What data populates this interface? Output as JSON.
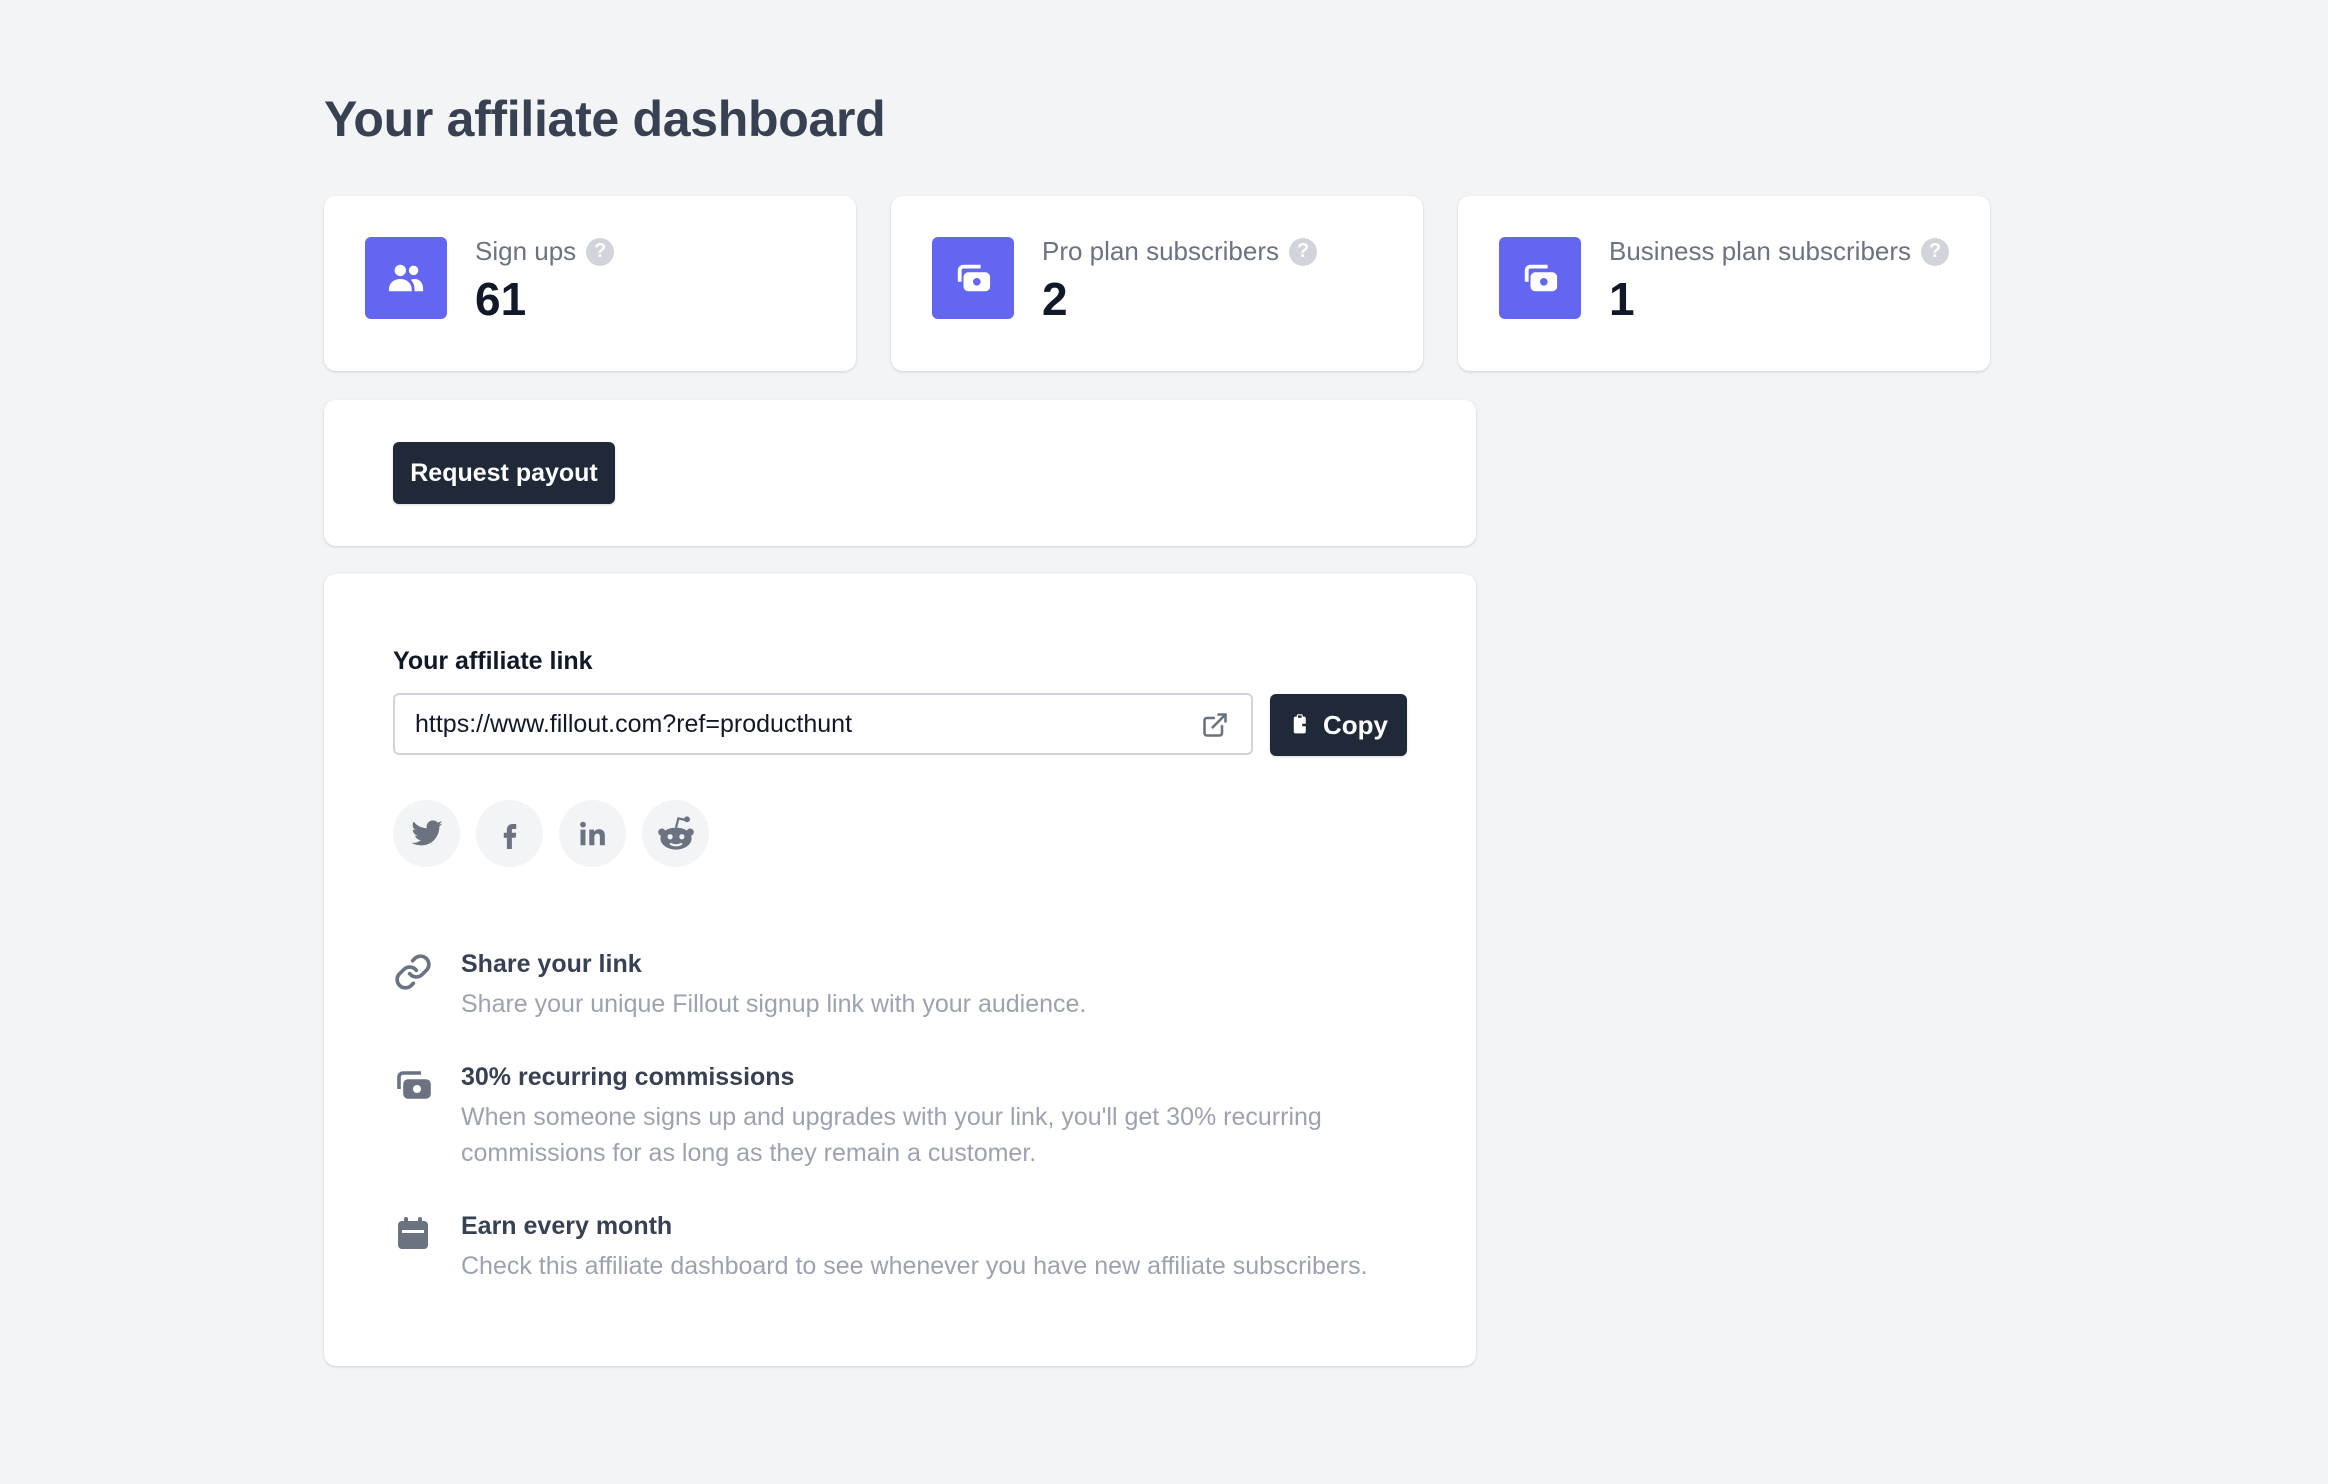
{
  "page": {
    "title": "Your affiliate dashboard"
  },
  "stats": [
    {
      "label": "Sign ups",
      "value": "61",
      "icon": "users-icon",
      "help": "?"
    },
    {
      "label": "Pro plan subscribers",
      "value": "2",
      "icon": "cash-icon",
      "help": "?"
    },
    {
      "label": "Business plan subscribers",
      "value": "1",
      "icon": "cash-icon",
      "help": "?"
    }
  ],
  "payout": {
    "button_label": "Request payout"
  },
  "affiliate_link": {
    "label": "Your affiliate link",
    "url": "https://www.fillout.com?ref=producthunt",
    "copy_label": "Copy",
    "socials": [
      "twitter-icon",
      "facebook-icon",
      "linkedin-icon",
      "reddit-icon"
    ]
  },
  "features": [
    {
      "icon": "link-icon",
      "title": "Share your link",
      "description": "Share your unique Fillout signup link with your audience."
    },
    {
      "icon": "cash-icon",
      "title": "30% recurring commissions",
      "description": "When someone signs up and upgrades with your link, you'll get 30% recurring commissions for as long as they remain a customer."
    },
    {
      "icon": "calendar-icon",
      "title": "Earn every month",
      "description": "Check this affiliate dashboard to see whenever you have new affiliate subscribers."
    }
  ],
  "colors": {
    "accent": "#6366f1",
    "button_dark": "#1f2937",
    "background": "#f3f4f6"
  }
}
